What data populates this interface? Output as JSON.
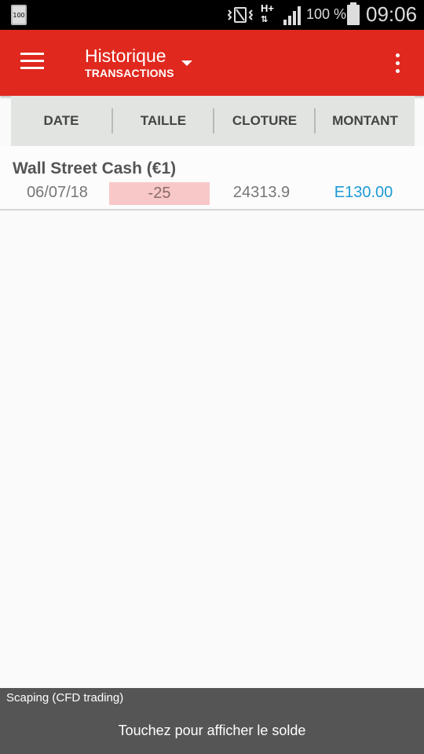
{
  "status_bar": {
    "left_icon_text": "100",
    "network": "H+",
    "battery_pct": "100 %",
    "time": "09:06",
    "icons": [
      "storage-icon",
      "vibrate-icon",
      "hplus-icon",
      "signal-icon",
      "battery-icon"
    ]
  },
  "app_bar": {
    "title": "Historique",
    "subtitle": "TRANSACTIONS",
    "color": "#e0281e",
    "icons": [
      "hamburger-menu-icon",
      "dropdown-arrow-icon",
      "overflow-menu-icon"
    ]
  },
  "table": {
    "headers": [
      "DATE",
      "TAILLE",
      "CLOTURE",
      "MONTANT"
    ],
    "rows": [
      {
        "name": "Wall Street Cash (€1)",
        "date": "06/07/18",
        "size": "-25",
        "close": "24313.9",
        "amount": "E130.00"
      }
    ]
  },
  "colors": {
    "negative_highlight": "#f8c8c8",
    "amount_text": "#1e9ad6",
    "bottom_bar": "#555555"
  },
  "bottom_bar": {
    "account": "Scaping (CFD trading)",
    "action": "Touchez pour afficher le solde"
  }
}
